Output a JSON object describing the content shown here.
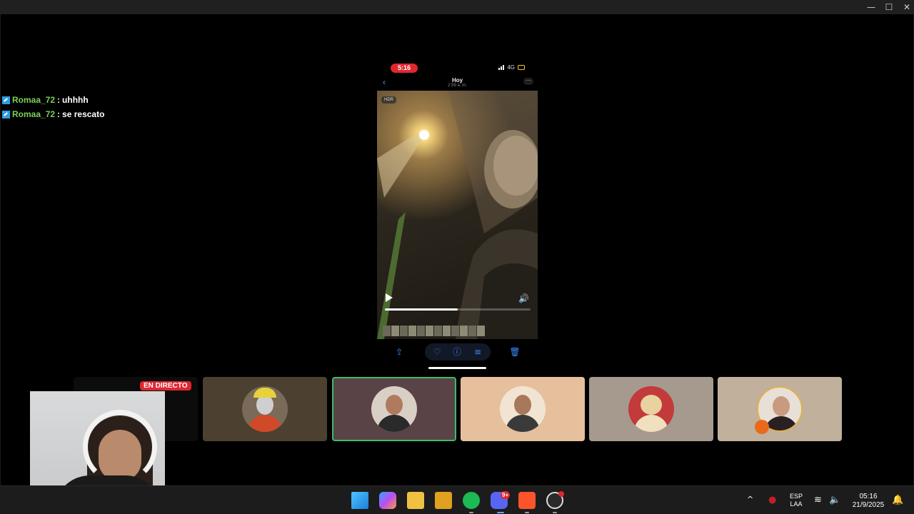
{
  "chat": {
    "lines": [
      {
        "user": "Romaa_72",
        "separator": ":",
        "message": "uhhhh"
      },
      {
        "user": "Romaa_72",
        "separator": ":",
        "message": "se rescato"
      }
    ]
  },
  "phone": {
    "status_time": "5:16",
    "network": "4G",
    "header_title": "Hoy",
    "header_subtitle": "2:59 a. m.",
    "hdr_badge": "HDR",
    "playback_progress": 0.5
  },
  "stream": {
    "live_badge": "EN DIRECTO"
  },
  "colors": {
    "accent_blue": "#3a8dff",
    "live_red": "#e0272f",
    "active_border": "#3bbd6b",
    "chat_user_green": "#7cd05a"
  },
  "taskbar": {
    "apps": [
      "windows-start",
      "copilot",
      "file-explorer",
      "media-player",
      "spotify",
      "discord",
      "brave",
      "obs"
    ],
    "discord_badge": "9+",
    "language": "ESP",
    "keyboard": "LAA",
    "clock_time": "05:16",
    "clock_date": "21/9/2025"
  },
  "window": {
    "minimize": "—",
    "maximize": "☐",
    "close": "✕"
  }
}
